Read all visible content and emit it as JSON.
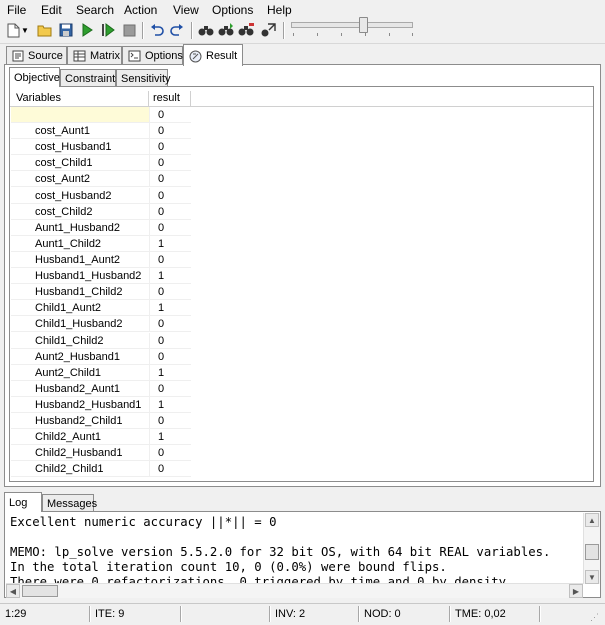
{
  "menu": {
    "items": [
      "File",
      "Edit",
      "Search",
      "Action",
      "View",
      "Options",
      "Help"
    ]
  },
  "toolbar": {
    "icons": [
      "new-file-icon",
      "dropdown-arrow-icon",
      "open-folder-icon",
      "save-icon",
      "run-icon",
      "step-icon",
      "stop-icon",
      "undo-icon",
      "redo-icon",
      "find-icon",
      "find-next-icon",
      "replace-icon",
      "goto-icon"
    ],
    "slider_level": 0.6
  },
  "main_tabs": [
    {
      "label": "Source",
      "icon": "source-icon"
    },
    {
      "label": "Matrix",
      "icon": "matrix-icon"
    },
    {
      "label": "Options",
      "icon": "options-icon"
    },
    {
      "label": "Result",
      "icon": "result-icon",
      "active": true
    }
  ],
  "sub_tabs": [
    {
      "label": "Objective",
      "active": true
    },
    {
      "label": "Constraints"
    },
    {
      "label": "Sensitivity"
    }
  ],
  "grid": {
    "headers": [
      "Variables",
      "result"
    ],
    "rows": [
      {
        "name": "",
        "value": "0"
      },
      {
        "name": "cost_Aunt1",
        "value": "0"
      },
      {
        "name": "cost_Husband1",
        "value": "0"
      },
      {
        "name": "cost_Child1",
        "value": "0"
      },
      {
        "name": "cost_Aunt2",
        "value": "0"
      },
      {
        "name": "cost_Husband2",
        "value": "0"
      },
      {
        "name": "cost_Child2",
        "value": "0"
      },
      {
        "name": "Aunt1_Husband2",
        "value": "0"
      },
      {
        "name": "Aunt1_Child2",
        "value": "1"
      },
      {
        "name": "Husband1_Aunt2",
        "value": "0"
      },
      {
        "name": "Husband1_Husband2",
        "value": "1"
      },
      {
        "name": "Husband1_Child2",
        "value": "0"
      },
      {
        "name": "Child1_Aunt2",
        "value": "1"
      },
      {
        "name": "Child1_Husband2",
        "value": "0"
      },
      {
        "name": "Child1_Child2",
        "value": "0"
      },
      {
        "name": "Aunt2_Husband1",
        "value": "0"
      },
      {
        "name": "Aunt2_Child1",
        "value": "1"
      },
      {
        "name": "Husband2_Aunt1",
        "value": "0"
      },
      {
        "name": "Husband2_Husband1",
        "value": "1"
      },
      {
        "name": "Husband2_Child1",
        "value": "0"
      },
      {
        "name": "Child2_Aunt1",
        "value": "1"
      },
      {
        "name": "Child2_Husband1",
        "value": "0"
      },
      {
        "name": "Child2_Child1",
        "value": "0"
      }
    ]
  },
  "bottom_tabs": [
    {
      "label": "Log",
      "active": true
    },
    {
      "label": "Messages"
    }
  ],
  "log": {
    "lines": [
      "Excellent numeric accuracy ||*|| = 0",
      "",
      "MEMO: lp_solve version 5.5.2.0 for 32 bit OS, with 64 bit REAL variables.",
      "In the total iteration count 10, 0 (0.0%) were bound flips.",
      "There were 0 refactorizations, 0 triggered by time and 0 by density."
    ]
  },
  "status": {
    "position": "1:29",
    "iterations": "ITE: 9",
    "blank": "",
    "inversions": "INV: 2",
    "nodes": "NOD: 0",
    "time": "TME: 0,02"
  }
}
